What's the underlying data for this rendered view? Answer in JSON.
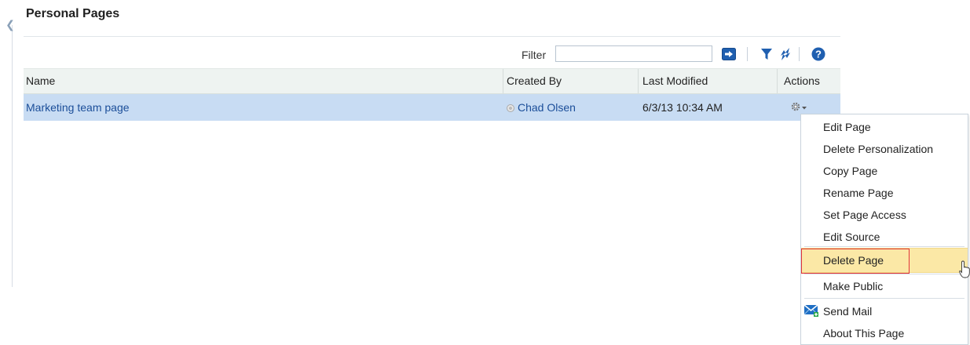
{
  "page": {
    "title": "Personal Pages"
  },
  "toolbar": {
    "filter_label": "Filter",
    "filter_value": "",
    "filter_placeholder": "",
    "icons": [
      "go-arrow-icon",
      "filter-funnel-icon",
      "refresh-icon",
      "help-icon"
    ]
  },
  "table": {
    "columns": [
      "Name",
      "Created By",
      "Last Modified",
      "Actions"
    ],
    "rows": [
      {
        "name": "Marketing team page",
        "created_by": "Chad Olsen",
        "last_modified": "6/3/13 10:34 AM"
      }
    ]
  },
  "menu": {
    "items": [
      {
        "label": "Edit Page"
      },
      {
        "label": "Delete Personalization"
      },
      {
        "label": "Copy Page"
      },
      {
        "label": "Rename Page"
      },
      {
        "label": "Set Page Access"
      },
      {
        "label": "Edit Source"
      },
      {
        "label": "Delete Page",
        "highlighted": true
      },
      {
        "label": "Make Public"
      },
      {
        "label": "Send Mail",
        "icon": "send-mail-icon"
      },
      {
        "label": "About This Page"
      }
    ]
  },
  "colors": {
    "selected_row": "#c8dcf3",
    "header_bg": "#eef3f1",
    "link": "#1b4e99",
    "menu_highlight": "#fbe8a6",
    "highlight_outline": "#e0353a",
    "icon_blue": "#1f5fb0"
  }
}
